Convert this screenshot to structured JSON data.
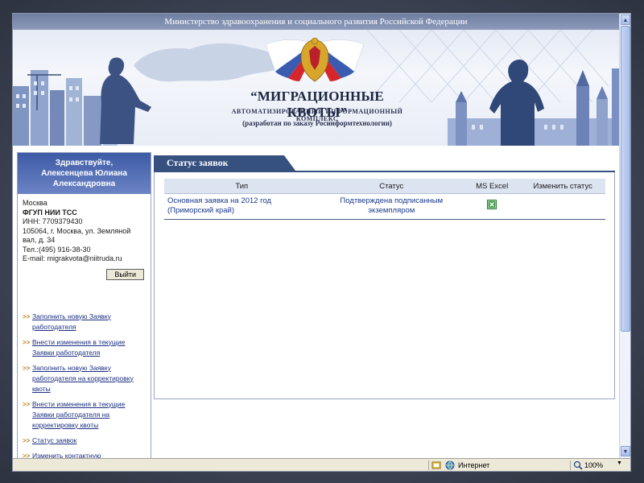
{
  "header": {
    "ministry": "Министерство здравоохранения и социального развития Российской Федерации",
    "title": "“МИГРАЦИОННЫЕ КВОТЫ”",
    "subtitle": "АВТОМАТИЗИРОВАННЫЙ ИНФОРМАЦИОННЫЙ КОМПЛЕКС",
    "credit": "(разработан по заказу Росинформтехнологии)"
  },
  "sidebar": {
    "greeting": [
      "Здравствуйте,",
      "Алексенцева Юлиана",
      "Александровна"
    ],
    "info": {
      "city": "Москва",
      "org": "ФГУП НИИ ТСС",
      "inn": "ИНН: 7709379430",
      "address_1": "105064, г. Москва, ул. Земляной",
      "address_2": "вал, д. 34",
      "phone": "Тел.:(495) 916-38-30",
      "email": "E-mail: migrakvota@niitruda.ru"
    },
    "logout_label": "Выйти",
    "bullet": ">>",
    "nav": [
      "Заполнить новую Заявку работодателя",
      "Внести изменения в текущие Заявки работодателя",
      "Заполнить новую Заявку работодателя на корректировку квоты",
      "Внести изменения в текущие Заявки работодателя на корректировку квоты",
      "Статус заявок",
      "Изменить контактную"
    ]
  },
  "main": {
    "tab_title": "Статус заявок",
    "columns": [
      "Тип",
      "Статус",
      "MS Excel",
      "Изменить статус"
    ],
    "rows": [
      {
        "type": "Основная заявка на 2012 год (Приморский край)",
        "status": "Подтверждена подписанным экземпляром",
        "excel_icon": "excel-file-icon",
        "change": ""
      }
    ]
  },
  "statusbar": {
    "zone": "Интернет",
    "zoom": "100%"
  },
  "colors": {
    "tab": "#36507f",
    "greeting_bg": "#3d5aa6",
    "link": "#1b2f80",
    "bullet": "#c5801a"
  }
}
